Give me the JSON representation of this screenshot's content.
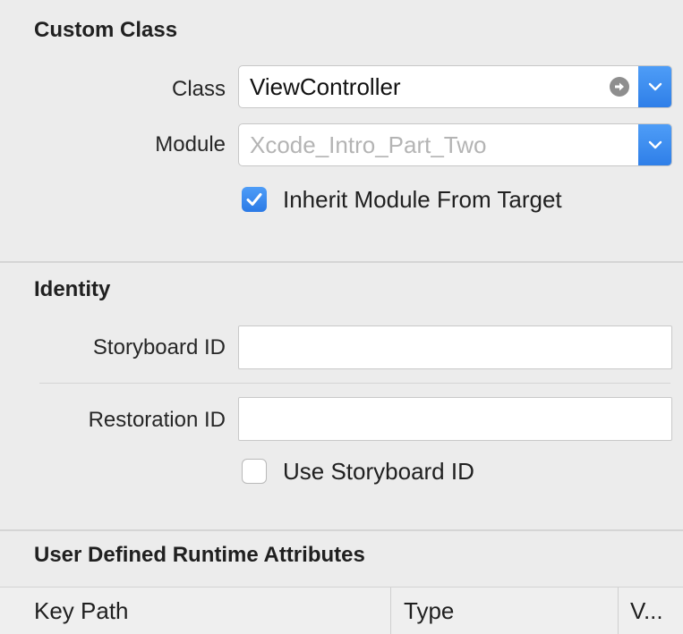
{
  "custom_class": {
    "title": "Custom Class",
    "class_label": "Class",
    "class_value": "ViewController",
    "module_label": "Module",
    "module_placeholder": "Xcode_Intro_Part_Two",
    "inherit_label": "Inherit Module From Target",
    "inherit_checked": true
  },
  "identity": {
    "title": "Identity",
    "storyboard_id_label": "Storyboard ID",
    "storyboard_id_value": "",
    "restoration_id_label": "Restoration ID",
    "restoration_id_value": "",
    "use_storyboard_label": "Use Storyboard ID",
    "use_storyboard_checked": false
  },
  "runtime_attributes": {
    "title": "User Defined Runtime Attributes",
    "columns": [
      "Key Path",
      "Type",
      "V..."
    ]
  },
  "colors": {
    "accent": "#2f7fe8",
    "background": "#ececec"
  },
  "icons": {
    "goto": "goto-arrow-icon",
    "popup": "chevron-down-icon",
    "check": "checkmark-icon"
  }
}
